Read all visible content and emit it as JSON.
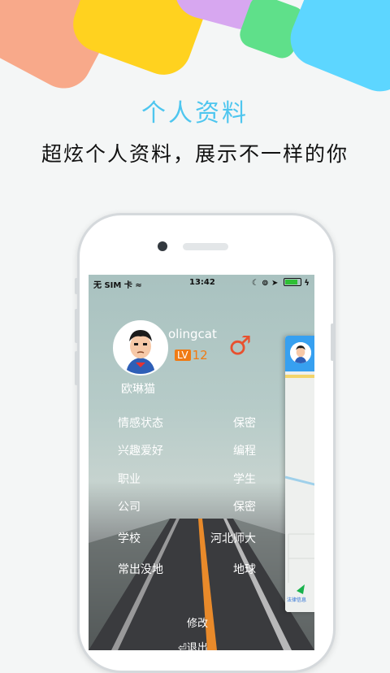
{
  "promo": {
    "title": "个人资料",
    "subtitle": "超炫个人资料，展示不一样的你"
  },
  "status_bar": {
    "carrier": "无 SIM 卡",
    "time": "13:42"
  },
  "profile": {
    "username": "olingcat",
    "level_badge": "LV",
    "level": "12",
    "gender_symbol": "♂",
    "nickname": "欧琳猫",
    "fields": [
      {
        "label": "情感状态",
        "value": "保密"
      },
      {
        "label": "兴趣爱好",
        "value": "编程"
      },
      {
        "label": "职业",
        "value": "学生"
      },
      {
        "label": "公司",
        "value": "保密"
      },
      {
        "label": "学校",
        "value": "河北师大"
      },
      {
        "label": "常出没地",
        "value": "地球"
      }
    ],
    "edit_label": "修改",
    "logout_label": "退出"
  },
  "map_card": {
    "legal_text": "法律信息"
  },
  "colors": {
    "title": "#4ec6ef",
    "gender": "#e8512f",
    "level": "#f07b14",
    "map_header": "#37a0f0"
  }
}
